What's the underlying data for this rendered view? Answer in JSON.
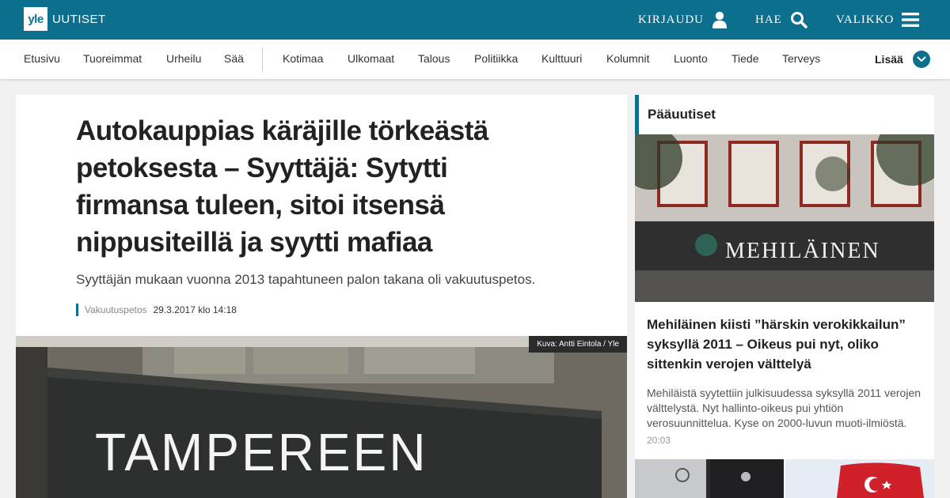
{
  "header": {
    "logo_box": "yle",
    "logo_text": "UUTISET",
    "login_label": "KIRJAUDU",
    "search_label": "HAE",
    "menu_label": "VALIKKO"
  },
  "nav": {
    "items": [
      "Etusivu",
      "Tuoreimmat",
      "Urheilu",
      "Sää",
      "Kotimaa",
      "Ulkomaat",
      "Talous",
      "Politiikka",
      "Kulttuuri",
      "Kolumnit",
      "Luonto",
      "Tiede",
      "Terveys"
    ],
    "more_label": "Lisää"
  },
  "article": {
    "headline": "Autokauppias käräjille törkeästä petoksesta – Syyttäjä: Sytytti firmansa tuleen, sitoi itsensä nippusiteillä ja syytti mafiaa",
    "lead": "Syyttäjän mukaan vuonna 2013 tapahtuneen palon takana oli vakuutuspetos.",
    "tag": "Vakuutuspetos",
    "date": "29.3.2017 klo 14:18",
    "image_credit": "Kuva: Antti Eintola / Yle",
    "image_sign_text": "TAMPEREEN"
  },
  "sidebar": {
    "heading": "Pääuutiset",
    "image_sign_text": "MEHILÄINEN",
    "story_title": "Mehiläinen kiisti ”härskin verokikkailun” syksyllä 2011 – Oikeus pui nyt, oliko sittenkin verojen välttelyä",
    "story_desc": "Mehiläistä syytettiin julkisuudessa syksyllä 2011 verojen välttelystä. Nyt hallinto-oikeus pui yhtiön verosuunnittelua. Kyse on 2000-luvun muoti-ilmiöstä.",
    "story_time": "20:03"
  },
  "colors": {
    "brand": "#0c6f8d",
    "background": "#f1f1f1"
  },
  "icons": {
    "login": "user-icon",
    "search": "search-icon",
    "menu": "hamburger-icon",
    "more": "chevron-down-icon"
  }
}
